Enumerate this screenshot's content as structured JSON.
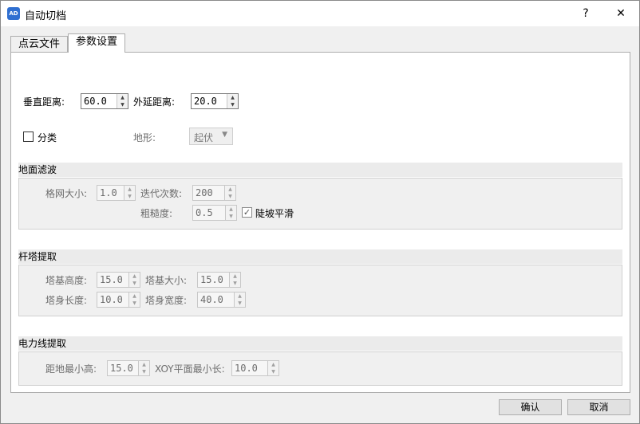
{
  "window": {
    "app_icon_text": "AD",
    "title": "自动切档",
    "help_glyph": "?",
    "close_glyph": "✕"
  },
  "tabs": [
    {
      "label": "点云文件",
      "active": false
    },
    {
      "label": "参数设置",
      "active": true
    }
  ],
  "params": {
    "vertical_distance": {
      "label": "垂直距离:",
      "value": "60.0"
    },
    "extend_distance": {
      "label": "外延距离:",
      "value": "20.0"
    },
    "classify": {
      "label": "分类",
      "checked": false
    },
    "terrain": {
      "label": "地形:",
      "value": "起伏",
      "enabled": false
    }
  },
  "ground_filter": {
    "title": "地面滤波",
    "grid_size": {
      "label": "格网大小:",
      "value": "1.0"
    },
    "iterations": {
      "label": "迭代次数:",
      "value": "200"
    },
    "roughness": {
      "label": "粗糙度:",
      "value": "0.5"
    },
    "steep_smooth": {
      "label": "陡坡平滑",
      "checked": true
    }
  },
  "tower_extract": {
    "title": "杆塔提取",
    "base_height": {
      "label": "塔基高度:",
      "value": "15.0"
    },
    "base_size": {
      "label": "塔基大小:",
      "value": "15.0"
    },
    "body_length": {
      "label": "塔身长度:",
      "value": "10.0"
    },
    "body_width": {
      "label": "塔身宽度:",
      "value": "40.0"
    }
  },
  "powerline_extract": {
    "title": "电力线提取",
    "min_ground_height": {
      "label": "距地最小高:",
      "value": "15.0"
    },
    "xoy_min_length": {
      "label": "XOY平面最小长:",
      "value": "10.0"
    }
  },
  "buttons": {
    "ok": "确认",
    "cancel": "取消"
  },
  "icons": {
    "spin_up": "▲",
    "spin_down": "▼",
    "combo_arrow": "▼",
    "check_mark": "✓"
  }
}
